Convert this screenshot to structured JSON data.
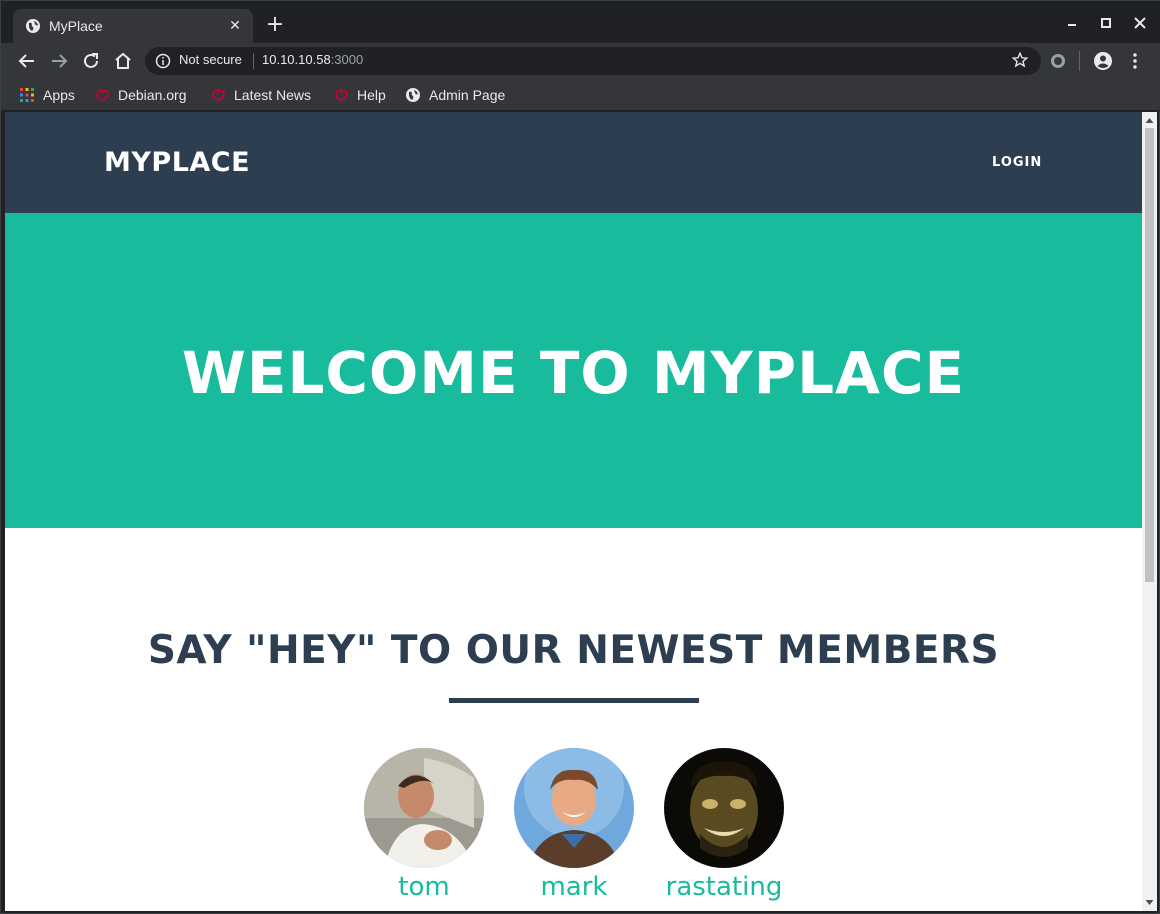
{
  "browser": {
    "tab_title": "MyPlace",
    "new_tab_symbol": "+",
    "security_label": "Not secure",
    "url_host": "10.10.10.58",
    "url_port": ":3000"
  },
  "bookmarks": [
    {
      "label": "Apps",
      "icon": "apps-grid-icon"
    },
    {
      "label": "Debian.org",
      "icon": "debian-swirl-icon"
    },
    {
      "label": "Latest News",
      "icon": "debian-swirl-icon"
    },
    {
      "label": "Help",
      "icon": "debian-swirl-icon"
    },
    {
      "label": "Admin Page",
      "icon": "globe-icon"
    }
  ],
  "site": {
    "brand": "MYPLACE",
    "login_label": "LOGIN",
    "hero_title": "WELCOME TO MYPLACE",
    "members_heading": "SAY \"HEY\" TO OUR NEWEST MEMBERS",
    "members": [
      {
        "name": "tom"
      },
      {
        "name": "mark"
      },
      {
        "name": "rastating"
      }
    ]
  },
  "colors": {
    "navbar": "#2c3e50",
    "accent": "#18bc9c",
    "browser_frame": "#35363a"
  }
}
